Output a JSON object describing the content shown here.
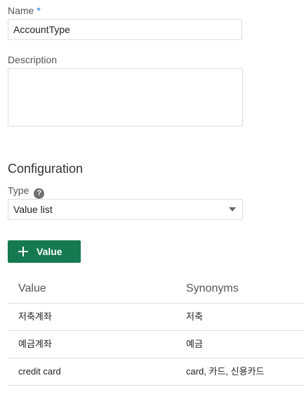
{
  "name_field": {
    "label": "Name",
    "required_marker": "*",
    "value": "AccountType"
  },
  "description_field": {
    "label": "Description",
    "value": ""
  },
  "configuration": {
    "title": "Configuration",
    "type_label": "Type",
    "help_icon": "?",
    "type_selected": "Value list",
    "add_button_label": "Value"
  },
  "table": {
    "headers": [
      "Value",
      "Synonyms"
    ],
    "rows": [
      {
        "value": "저축계좌",
        "synonyms": "저축"
      },
      {
        "value": "예금계좌",
        "synonyms": "예금"
      },
      {
        "value": "credit card",
        "synonyms": "card, 카드, 신용카드"
      }
    ]
  },
  "colors": {
    "accent": "#157a4f",
    "required": "#1a73e8"
  }
}
